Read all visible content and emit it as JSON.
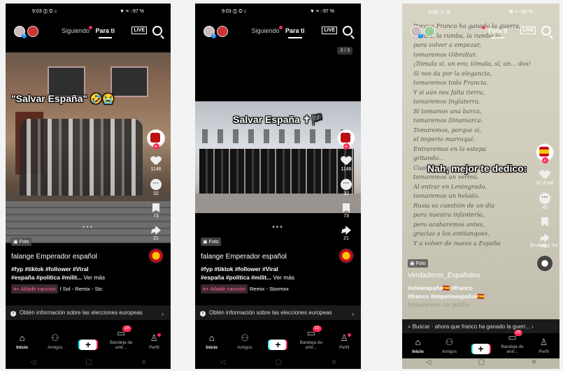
{
  "phone1": {
    "status": {
      "time": "9:03",
      "left_icons": "Ⓢ ◎ ೦",
      "right": "▼ ≡ ◌97 %"
    },
    "tabs": {
      "following": "Siguiendo",
      "for_you": "Para ti"
    },
    "live": "LIVE",
    "caption": "\"Salvar España\" 🤣😭",
    "rail": {
      "likes": "1146",
      "comments": "32",
      "saves": "73",
      "shares": "21"
    },
    "badge": "Foto",
    "username": "falange Emperador español",
    "description": "#fyp #tiktok #follower #Viral",
    "description2": "#españa #política #milit...",
    "more": "Ver más",
    "add_song": "Añadir canción",
    "music": "l Sol - Remix - Stc",
    "info": "Obtén información sobre las elecciones europeas",
    "nav": {
      "home": "Inicio",
      "friends": "Amigos",
      "inbox": "Bandeja de entr...",
      "inbox_count": "15",
      "profile": "Perfil"
    }
  },
  "phone2": {
    "status": {
      "time": "9:03",
      "left_icons": "Ⓢ ◎ ೦",
      "right": "▼ ≡ ◌97 %"
    },
    "tabs": {
      "following": "Siguiendo",
      "for_you": "Para ti"
    },
    "live": "LIVE",
    "counter": "3 / 3",
    "caption": "Salvar España ✝🏴",
    "rail": {
      "likes": "1146",
      "comments": "32",
      "saves": "73",
      "shares": "21"
    },
    "badge": "Foto",
    "username": "falange Emperador español",
    "description": "#fyp #tiktok #follower #Viral",
    "description2": "#españa #política #milit...",
    "more": "Ver más",
    "add_song": "Añadir canción",
    "music": "Remix - Stormxx",
    "info": "Obtén información sobre las elecciones europeas",
    "nav": {
      "home": "Inicio",
      "friends": "Amigos",
      "inbox": "Bandeja de entr...",
      "inbox_count": "15",
      "profile": "Perfil"
    }
  },
  "phone3": {
    "status": {
      "time": "9:06",
      "left_icons": "Ⓢ ▣",
      "right": "✖ ≡ ◌99 %"
    },
    "tabs": {
      "following": "Siguiendo",
      "for_you": "Para ti"
    },
    "live": "LIVE",
    "poem": "Porque Franco ha ganado la guerra,\nrumba, la rumba, la rumba la...\npara volver a empezar,\ntomaremos Gibraltar.\n¡Tómala sí, un ero; tómala, sí, un... dos!\nSi nos da por la elegancia,\ntomaremos toda Francia.\nY si aún nos falta tierra,\ntomaremos Inglaterra.\nSi tomamos una barca,\ntomaremos Dinamarca.\nTomaremos, porque sí,\nel imperio marroquí.\nEntraremos en la estepa\ngritando...\nCuando estemos en Moscú,\ntomaremos un vermú.\nAl entrar en Leningrado,\ntomaremos un helado.\nRusia es cuestión de un día\npara nuestra infantería,\npero acabaremos antes,\ngracias a los antitanques.\nY a volver de nuevo a España",
    "caption": "Nah, mejor te dedico:",
    "rail": {
      "likes": "37,6 mil",
      "comments": "45",
      "saves": "",
      "shares": "4861"
    },
    "music_tag": "@calbug… Rei",
    "badge": "Foto",
    "username": "Verdaderos_Españoles",
    "description": "#vivaespaña🇪🇸 #franco",
    "description2": "#franco #imperioespañol🇪🇸",
    "description3": "tomaremos un pitillo",
    "search": "Buscar · ahora que franco ha ganado la guerr...",
    "nav": {
      "home": "Inicio",
      "friends": "Amigos",
      "inbox": "Bandeja de entr...",
      "inbox_count": "16",
      "profile": "Perfil"
    }
  }
}
